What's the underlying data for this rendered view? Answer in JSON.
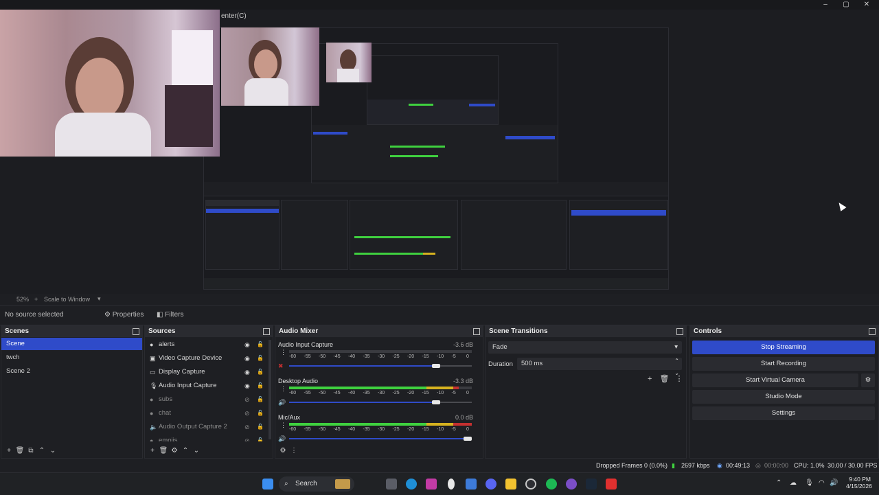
{
  "window": {
    "title_fragment": "enter(C)",
    "controls": [
      "minimize",
      "maximize",
      "close"
    ]
  },
  "preview": {
    "nested_window_title": "",
    "cursor_icon": "pointer-cursor"
  },
  "zoom_bar": {
    "zoom": "52%",
    "mode": "Scale to Window"
  },
  "context_bar": {
    "source_label": "No source selected",
    "properties_label": "Properties",
    "filters_label": "Filters"
  },
  "scenes": {
    "title": "Scenes",
    "items": [
      {
        "label": "Scene",
        "selected": true
      },
      {
        "label": "twch",
        "selected": false
      },
      {
        "label": "Scene 2",
        "selected": false
      }
    ]
  },
  "sources": {
    "title": "Sources",
    "items": [
      {
        "label": "alerts",
        "icon": "browser-icon",
        "visible": true
      },
      {
        "label": "Video Capture Device",
        "icon": "camera-icon",
        "visible": true
      },
      {
        "label": "Display Capture",
        "icon": "monitor-icon",
        "visible": true
      },
      {
        "label": "Audio Input Capture",
        "icon": "microphone-icon",
        "visible": true
      },
      {
        "label": "subs",
        "icon": "browser-icon",
        "visible": false
      },
      {
        "label": "chat",
        "icon": "browser-icon",
        "visible": false
      },
      {
        "label": "Audio Output Capture 2",
        "icon": "speaker-icon",
        "visible": false
      },
      {
        "label": "emojis",
        "icon": "browser-icon",
        "visible": false
      }
    ]
  },
  "mixer": {
    "title": "Audio Mixer",
    "ticks": [
      "-60",
      "-55",
      "-50",
      "-45",
      "-40",
      "-35",
      "-30",
      "-25",
      "-20",
      "-15",
      "-10",
      "-5",
      "0"
    ],
    "channels": [
      {
        "name": "Audio Input Capture",
        "db": "-3.6 dB",
        "level": 0.0,
        "volume": 0.82,
        "muted": true
      },
      {
        "name": "Desktop Audio",
        "db": "-3.3 dB",
        "level": 0.93,
        "volume": 0.82,
        "muted": false
      },
      {
        "name": "Mic/Aux",
        "db": "0.0 dB",
        "level": 1.0,
        "volume": 1.0,
        "muted": false
      }
    ]
  },
  "transitions": {
    "title": "Scene Transitions",
    "transition": "Fade",
    "duration_label": "Duration",
    "duration_value": "500 ms"
  },
  "controls": {
    "title": "Controls",
    "stop_streaming": "Stop Streaming",
    "start_recording": "Start Recording",
    "start_virtual_camera": "Start Virtual Camera",
    "studio_mode": "Studio Mode",
    "settings": "Settings"
  },
  "status": {
    "dropped_frames": "Dropped Frames 0 (0.0%)",
    "bitrate": "2697 kbps",
    "stream_time": "00:49:13",
    "record_time": "00:00:00",
    "cpu": "CPU: 1.0%",
    "fps": "30.00 / 30.00 FPS"
  },
  "taskbar": {
    "search_placeholder": "Search",
    "time": "9:40 PM",
    "date": "4/15/2026"
  },
  "colors": {
    "accent": "#2f4bc9",
    "meter_green": "#3fd13f",
    "meter_yellow": "#d6b21f",
    "meter_red": "#c43030",
    "background": "#1e1f23"
  }
}
